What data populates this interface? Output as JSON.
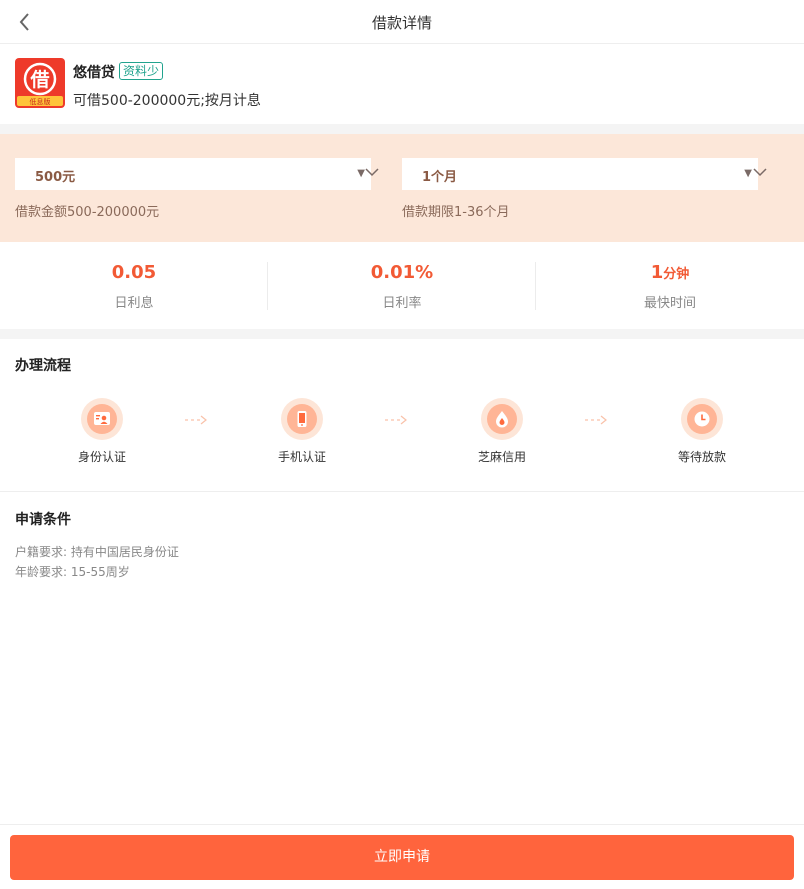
{
  "nav": {
    "title": "借款详情"
  },
  "product": {
    "name": "悠借贷",
    "tag": "资料少",
    "description": "可借500-200000元;按月计息",
    "logo_char": "借",
    "logo_ribbon": "低息版"
  },
  "selectors": {
    "amount": {
      "value": "500元",
      "label": "借款金额500-200000元"
    },
    "term": {
      "value": "1个月",
      "label": "借款期限1-36个月"
    }
  },
  "stats": [
    {
      "value": "0.05",
      "unit": "",
      "label": "日利息"
    },
    {
      "value": "0.01%",
      "unit": "",
      "label": "日利率"
    },
    {
      "value": "1",
      "unit": "分钟",
      "label": "最快时间"
    }
  ],
  "process": {
    "title": "办理流程",
    "steps": [
      {
        "label": "身份认证",
        "icon": "id-card-icon"
      },
      {
        "label": "手机认证",
        "icon": "phone-icon"
      },
      {
        "label": "芝麻信用",
        "icon": "sesame-credit-icon"
      },
      {
        "label": "等待放款",
        "icon": "clock-icon"
      }
    ]
  },
  "conditions": {
    "title": "申请条件",
    "lines": [
      "户籍要求: 持有中国居民身份证",
      "年龄要求: 15-55周岁"
    ]
  },
  "apply_label": "立即申请",
  "colors": {
    "accent": "#ff643d",
    "stat_value": "#f25a35",
    "selector_bg": "#fce7d9",
    "tag": "#21a38e"
  }
}
